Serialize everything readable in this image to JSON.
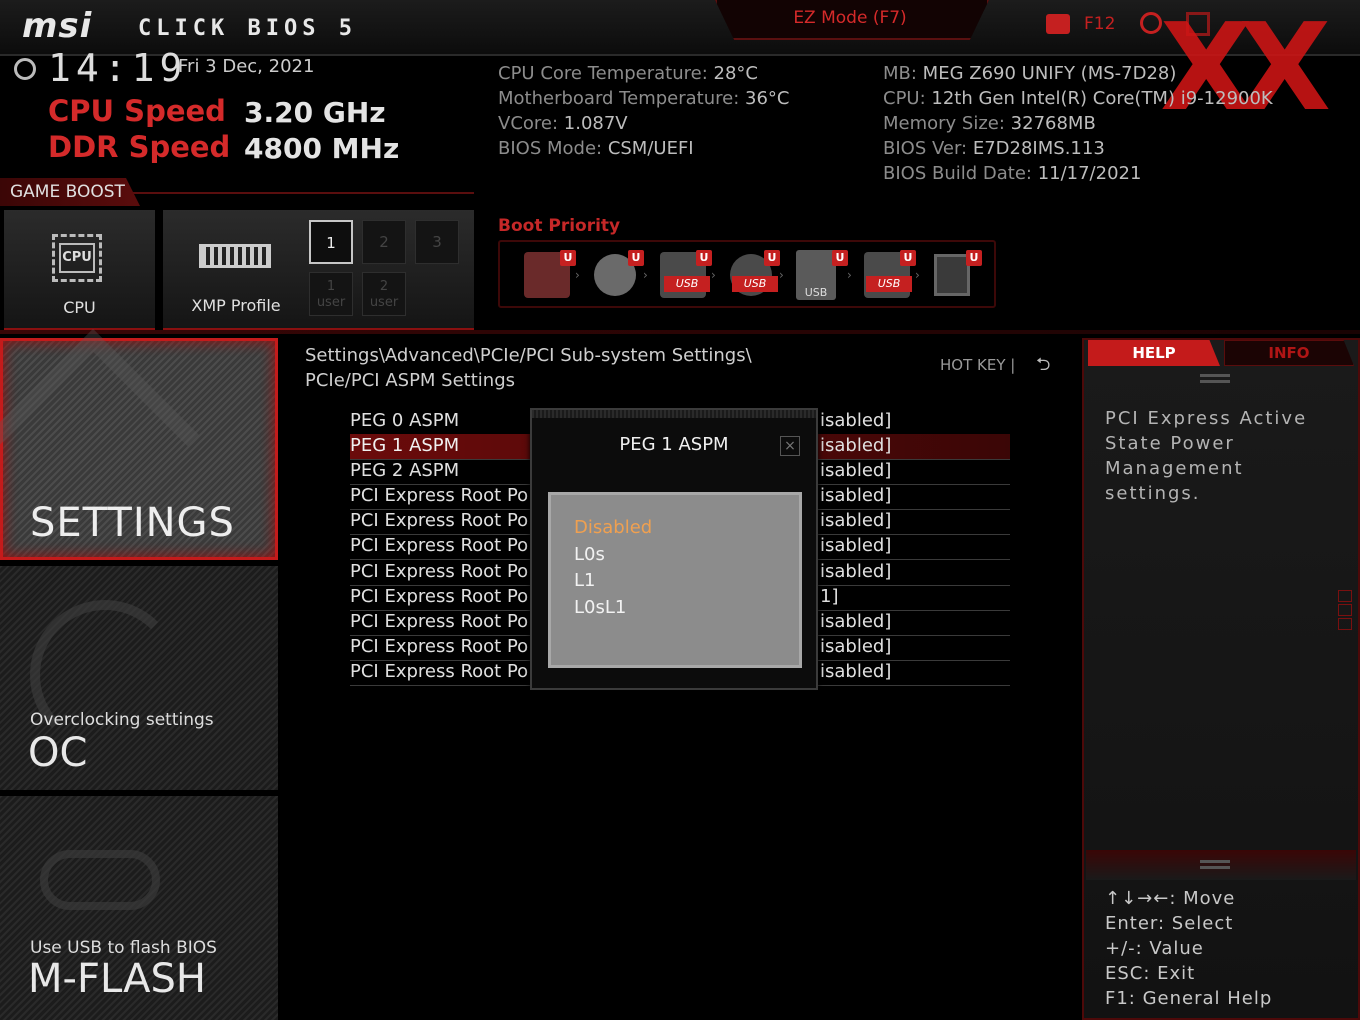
{
  "topbar": {
    "logo": "msi",
    "bios_name": "CLICK BIOS 5",
    "ez_mode": "EZ Mode (F7)",
    "screenshot_key": "F12",
    "watermark": "XX"
  },
  "status": {
    "time": "14:19",
    "date": "Fri  3 Dec, 2021",
    "cpu_speed_label": "CPU Speed",
    "cpu_speed_value": "3.20 GHz",
    "ddr_speed_label": "DDR Speed",
    "ddr_speed_value": "4800 MHz"
  },
  "sysinfo_left": [
    {
      "k": "CPU Core Temperature: ",
      "v": "28°C"
    },
    {
      "k": "Motherboard Temperature: ",
      "v": "36°C"
    },
    {
      "k": "VCore: ",
      "v": "1.087V"
    },
    {
      "k": "BIOS Mode: ",
      "v": "CSM/UEFI"
    }
  ],
  "sysinfo_right": [
    {
      "k": "MB: ",
      "v": "MEG Z690 UNIFY (MS-7D28)"
    },
    {
      "k": "CPU: ",
      "v": "12th Gen Intel(R) Core(TM) i9-12900K"
    },
    {
      "k": "Memory Size: ",
      "v": "32768MB"
    },
    {
      "k": "BIOS Ver: ",
      "v": "E7D28IMS.113"
    },
    {
      "k": "BIOS Build Date: ",
      "v": "11/17/2021"
    }
  ],
  "game_boost": {
    "label": "GAME BOOST",
    "cpu_label": "CPU",
    "cpu_icon_text": "CPU",
    "xmp_label": "XMP Profile",
    "profiles": [
      "1",
      "2",
      "3"
    ],
    "user_profiles": [
      {
        "n": "1",
        "t": "user"
      },
      {
        "n": "2",
        "t": "user"
      }
    ]
  },
  "boot": {
    "title": "Boot Priority",
    "badge": "U",
    "usb_text": "USB",
    "devices": [
      "hdd-icon",
      "optical-disc-icon",
      "usb-drive-icon",
      "usb-disc-icon",
      "usb-stick-icon",
      "usb-floppy-icon",
      "network-icon"
    ]
  },
  "nav": {
    "settings": "SETTINGS",
    "oc_sub": "Overclocking settings",
    "oc": "OC",
    "mflash_sub": "Use USB to flash BIOS",
    "mflash": "M-FLASH"
  },
  "main": {
    "breadcrumb_line1": "Settings\\Advanced\\PCIe/PCI Sub-system Settings\\",
    "breadcrumb_line2": "PCIe/PCI ASPM Settings",
    "hotkey": "HOT KEY   |",
    "back": "⮌",
    "rows": [
      {
        "label": "PEG 0 ASPM",
        "value": "isabled]"
      },
      {
        "label": "PEG 1 ASPM",
        "value": "isabled]"
      },
      {
        "label": "PEG 2 ASPM",
        "value": "isabled]"
      },
      {
        "label": "PCI Express Root Po",
        "value": "isabled]"
      },
      {
        "label": "PCI Express Root Po",
        "value": "isabled]"
      },
      {
        "label": "PCI Express Root Po",
        "value": "isabled]"
      },
      {
        "label": "PCI Express Root Po",
        "value": "isabled]"
      },
      {
        "label": "PCI Express Root Po",
        "value": "1]"
      },
      {
        "label": "PCI Express Root Po",
        "value": "isabled]"
      },
      {
        "label": "PCI Express Root Po",
        "value": "isabled]"
      },
      {
        "label": "PCI Express Root Po",
        "value": "isabled]"
      }
    ]
  },
  "dialog": {
    "title": "PEG 1 ASPM",
    "close": "×",
    "options": [
      "Disabled",
      "L0s",
      "L1",
      "L0sL1"
    ]
  },
  "help": {
    "tab_help": "HELP",
    "tab_info": "INFO",
    "text": "PCI Express Active State Power Management settings.",
    "keys": [
      "↑↓→←: Move",
      "Enter: Select",
      "+/-: Value",
      "ESC: Exit",
      "F1: General Help"
    ]
  },
  "colors": {
    "accent": "#c41b1b",
    "selected_option": "#f0a050"
  }
}
